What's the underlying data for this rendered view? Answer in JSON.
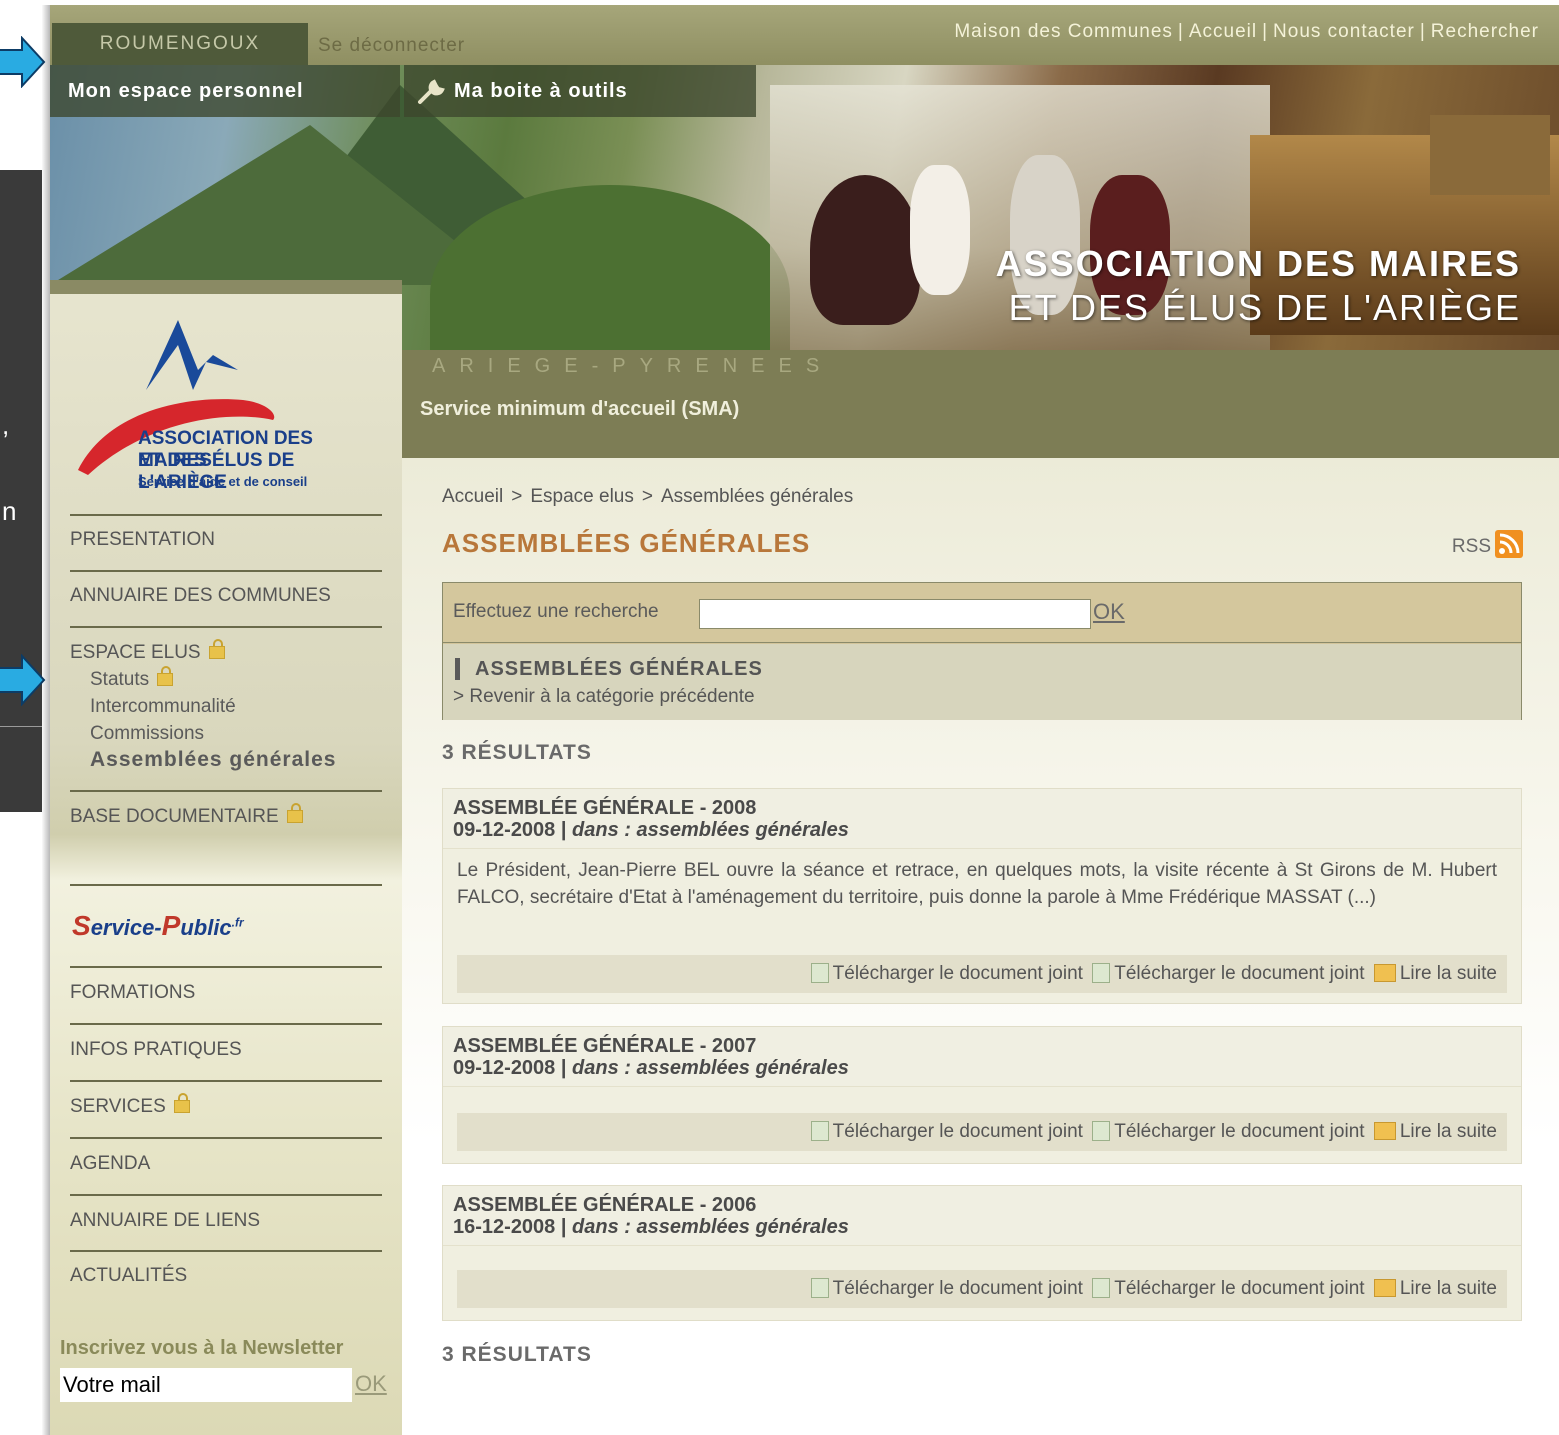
{
  "topbar": {
    "user_tab": "ROUMENGOUX",
    "logout": "Se déconnecter",
    "links": [
      "Maison des Communes",
      "Accueil",
      "Nous contacter",
      "Rechercher"
    ],
    "separator": "|"
  },
  "banner": {
    "tab_personal": "Mon espace personnel",
    "tab_tools": "Ma boite à outils",
    "title_line1": "ASSOCIATION DES MAIRES",
    "title_line2": "ET DES ÉLUS DE L'ARIÈGE"
  },
  "subheader": {
    "region": "ARIEGE-PYRENEES",
    "section": "Service minimum d'accueil (SMA)"
  },
  "logo": {
    "line1": "ASSOCIATION DES MAIRES",
    "line2": "ET DES ÉLUS DE L'ARIÈGE",
    "line3": "Service d'aide et de conseil"
  },
  "overlay": {
    "frag1": ",",
    "frag2": "n"
  },
  "sidebar": {
    "items": [
      {
        "label": "PRESENTATION"
      },
      {
        "label": "ANNUAIRE DES COMMUNES"
      },
      {
        "label": "ESPACE ELUS"
      },
      {
        "label": "BASE DOCUMENTAIRE"
      },
      {
        "label": "FORMATIONS"
      },
      {
        "label": "INFOS PRATIQUES"
      },
      {
        "label": "SERVICES"
      },
      {
        "label": "AGENDA"
      },
      {
        "label": "ANNUAIRE DE LIENS"
      },
      {
        "label": "ACTUALITÉS"
      }
    ],
    "sub_items": [
      {
        "label": "Statuts"
      },
      {
        "label": "Intercommunalité"
      },
      {
        "label": "Commissions"
      },
      {
        "label": "Assemblées générales"
      }
    ],
    "service_public": {
      "a": "S",
      "b": "ervice-",
      "c": "P",
      "d": "ublic",
      "e": ".fr"
    },
    "newsletter_label": "Inscrivez vous à la Newsletter",
    "newsletter_value": "Votre mail",
    "newsletter_ok": "OK"
  },
  "main": {
    "breadcrumb": [
      "Accueil",
      "Espace elus",
      "Assemblées générales"
    ],
    "breadcrumb_sep": ">",
    "title": "ASSEMBLÉES GÉNÉRALES",
    "rss": "RSS",
    "search_label": "Effectuez une recherche",
    "search_value": "",
    "search_ok": "OK",
    "category_title": "ASSEMBLÉES GÉNÉRALES",
    "category_back": "> Revenir à la catégorie précédente",
    "results_count": "3 RÉSULTATS",
    "results": [
      {
        "title": "ASSEMBLÉE GÉNÉRALE - 2008",
        "date": "09-12-2008 | ",
        "category": "dans : assemblées générales",
        "summary": "Le Président, Jean-Pierre BEL ouvre la séance et retrace, en quelques mots, la visite récente à St Girons de M. Hubert FALCO, secrétaire d'Etat à l'aménagement du territoire, puis donne la parole à Mme Frédérique MASSAT (...)"
      },
      {
        "title": "ASSEMBLÉE GÉNÉRALE - 2007",
        "date": "09-12-2008 | ",
        "category": "dans : assemblées générales",
        "summary": ""
      },
      {
        "title": "ASSEMBLÉE GÉNÉRALE - 2006",
        "date": "16-12-2008 | ",
        "category": "dans : assemblées générales",
        "summary": ""
      }
    ],
    "action_download": "Télécharger le document joint",
    "action_read": "Lire la suite"
  },
  "colors": {
    "accent_title": "#b8773a",
    "topbar": "#8f8f62",
    "subheader": "#7d7d55",
    "overlay_arrow": "#29abe2"
  }
}
